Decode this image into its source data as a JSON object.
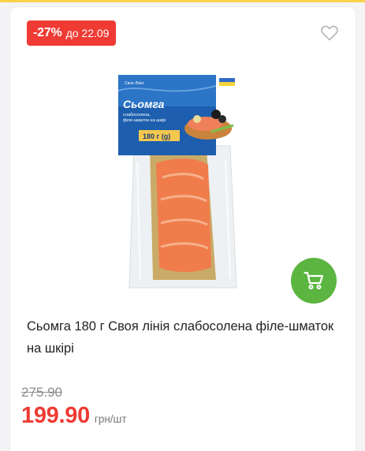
{
  "discount": {
    "percent": "-27%",
    "until": "до 22.09"
  },
  "product": {
    "title": "Сьомга 180 г Своя лінія слабосолена філе-шматок на шкірі",
    "package": {
      "brand": "Своя Лінія",
      "name": "Сьомга",
      "subtitle_line1": "слабосолена,",
      "subtitle_line2": "філе-шматок на шкірі",
      "weight": "180 г (g)"
    }
  },
  "pricing": {
    "old_price": "275.90",
    "price": "199.90",
    "unit": "грн/шт"
  },
  "icons": {
    "favorite": "heart-outline-icon",
    "cart": "cart-icon"
  },
  "colors": {
    "accent_red": "#ef3b34",
    "cart_green": "#5bb540",
    "top_stripe": "#f6d34a"
  }
}
